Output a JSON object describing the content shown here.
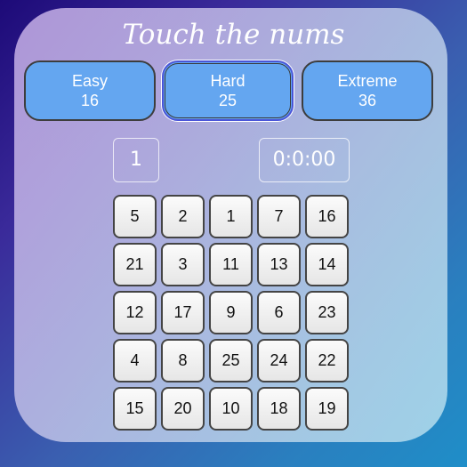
{
  "title": "Touch the nums",
  "modes": [
    {
      "name": "Easy",
      "count": "16"
    },
    {
      "name": "Hard",
      "count": "25"
    },
    {
      "name": "Extreme",
      "count": "36"
    }
  ],
  "selected_mode": "Hard",
  "next_number": "1",
  "timer": "0:0:00",
  "grid": [
    "5",
    "2",
    "1",
    "7",
    "16",
    "21",
    "3",
    "11",
    "13",
    "14",
    "12",
    "17",
    "9",
    "6",
    "23",
    "4",
    "8",
    "25",
    "24",
    "22",
    "15",
    "20",
    "10",
    "18",
    "19"
  ]
}
